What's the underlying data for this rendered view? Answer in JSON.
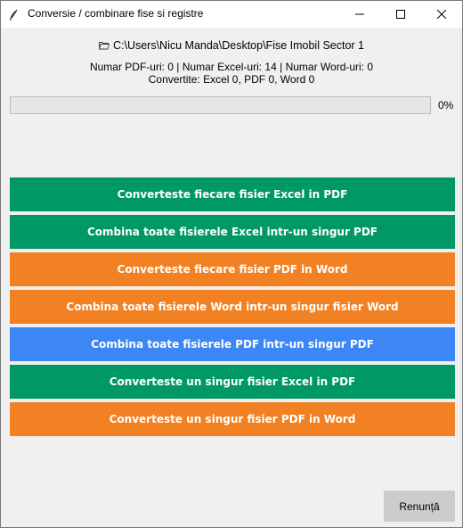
{
  "window": {
    "title": "Conversie / combinare fise si registre",
    "icon": "feather-icon"
  },
  "header": {
    "folder_icon": "folder-icon",
    "path": "C:\\Users\\Nicu Manda\\Desktop\\Fise Imobil Sector 1",
    "counts": "Numar PDF-uri: 0 | Numar Excel-uri: 14 | Numar Word-uri: 0",
    "converted": "Convertite: Excel 0, PDF 0, Word 0"
  },
  "progress": {
    "value": 0,
    "label": "0%"
  },
  "actions": [
    {
      "label": "Converteste fiecare fisier Excel in PDF",
      "color": "#009966"
    },
    {
      "label": "Combina toate fisierele Excel intr-un singur PDF",
      "color": "#009966"
    },
    {
      "label": "Converteste fiecare fisier PDF in Word",
      "color": "#f28123"
    },
    {
      "label": "Combina toate fisierele Word intr-un singur fisier Word",
      "color": "#f28123"
    },
    {
      "label": "Combina toate fisierele PDF intr-un singur PDF",
      "color": "#3d86f5"
    },
    {
      "label": "Converteste un singur fisier Excel in PDF",
      "color": "#009966"
    },
    {
      "label": "Converteste un singur fisier PDF in Word",
      "color": "#f28123"
    }
  ],
  "footer": {
    "cancel_label": "Renunță"
  }
}
